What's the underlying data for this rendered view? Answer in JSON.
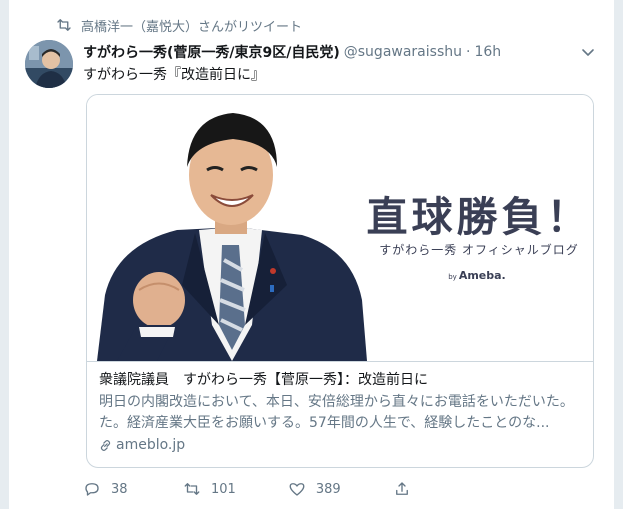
{
  "retweet_context": {
    "icon": "retweet-icon",
    "text": "高橋洋一（嘉悦大）さんがリツイート"
  },
  "tweet": {
    "display_name": "すがわら一秀(菅原一秀/東京9区/自民党)",
    "screen_name": "@sugawaraisshu",
    "separator": "·",
    "timestamp": "16h",
    "text": "すがわら一秀『改造前日に』",
    "caret_icon": "chevron-down-icon"
  },
  "card": {
    "image": {
      "title": "直球勝負！",
      "subtitle": "すがわら一秀 オフィシャルブログ",
      "brand_by": "by",
      "brand_name": "Ameba."
    },
    "title": "衆議院議員　すがわら一秀【菅原一秀】：改造前日に",
    "description_line1": "明日の内閣改造において、本日、安倍総理から直々にお電話をいただいた。",
    "description_line2": "た。経済産業大臣をお願いする。57年間の人生で、経験したことのな...",
    "domain": "ameblo.jp",
    "domain_icon": "link-icon"
  },
  "actions": {
    "reply": {
      "icon": "reply-icon",
      "count": "38"
    },
    "retweet": {
      "icon": "retweet-icon",
      "count": "101"
    },
    "like": {
      "icon": "heart-icon",
      "count": "389"
    },
    "share": {
      "icon": "share-icon"
    }
  },
  "colors": {
    "text_primary": "#14171a",
    "text_secondary": "#657786",
    "border": "#ccd6dd",
    "background": "#e6ecf0"
  }
}
